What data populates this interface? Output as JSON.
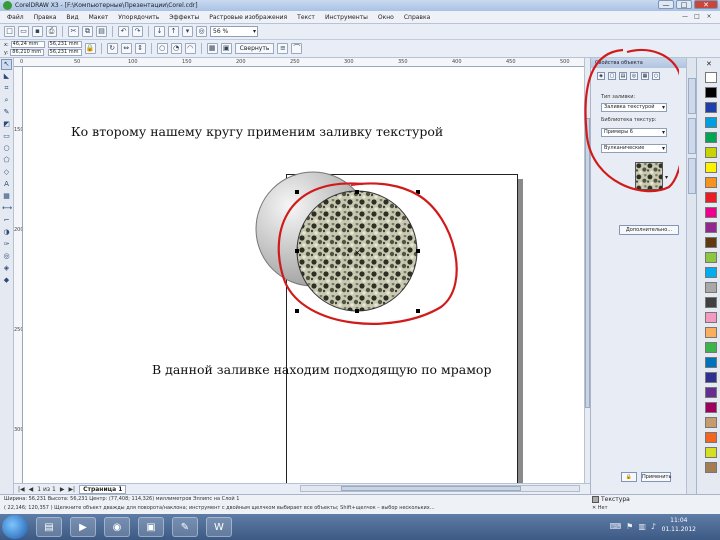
{
  "window": {
    "title": "CorelDRAW X3 - [F:\\Компьютерные\\Презентации\\Corel.cdr]",
    "controls": [
      "—",
      "□",
      "✕"
    ]
  },
  "menu": {
    "items": [
      "Файл",
      "Правка",
      "Вид",
      "Макет",
      "Упорядочить",
      "Эффекты",
      "Растровые изображения",
      "Текст",
      "Инструменты",
      "Окно",
      "Справка"
    ],
    "doc_controls": [
      "—",
      "□",
      "×"
    ]
  },
  "toolbar": {
    "zoom_value": "56 %",
    "snap_label": "Свернуть"
  },
  "propbar": {
    "x_value": "46,24 mm",
    "y_value": "86,210 mm",
    "w_value": "56,231 mm",
    "h_value": "56,231 mm"
  },
  "ruler": {
    "h_ticks": [
      "0",
      "50",
      "100",
      "150",
      "200",
      "250",
      "300",
      "350",
      "400",
      "450",
      "500"
    ],
    "v_ticks": [
      "150",
      "200",
      "250",
      "300"
    ]
  },
  "canvas": {
    "caption_top": "Ко второму нашему кругу применим заливку текстурой",
    "caption_bottom": "В данной заливке находим подходящую по мрамор"
  },
  "docker": {
    "title": "Свойства объекта",
    "fill_type_label": "Тип заливки:",
    "fill_type_value": "Заливка текстурой",
    "library_label": "Библиотека текстур:",
    "library_value": "Примеры 6",
    "texture_value": "Вулканические",
    "more_button": "Дополнительно...",
    "apply_button": "Применить"
  },
  "pagebar": {
    "page_count": "1 из 1",
    "page_tab": "Страница 1"
  },
  "status": {
    "line1": "Ширина: 56,231  Высота: 56,231  Центр: (77,408; 114,326) миллиметров    Эллипс на Слой 1",
    "line2": "( 22,146; 120,357 )   Щелкните объект дважды для поворота/наклона; инструмент с двойным щелчком выбирает все объекты; Shift+щелчок – выбор нескольких...",
    "fill_name": "Текстура",
    "stroke_name": "Нет"
  },
  "taskbar": {
    "time": "11:04",
    "date": "01.11.2012",
    "apps": [
      "explorer",
      "media",
      "corel",
      "presentation",
      "paint",
      "word"
    ]
  },
  "palette_colors": [
    "#ffffff",
    "#000000",
    "#1f3fa8",
    "#00a0e0",
    "#00a651",
    "#c8d400",
    "#fff200",
    "#f7941d",
    "#ed1c24",
    "#ec008c",
    "#92278f",
    "#603913",
    "#8dc63f",
    "#00aeef",
    "#a8a8a8",
    "#404040",
    "#f49ac1",
    "#fbaf5d",
    "#39b54a",
    "#0072bc",
    "#2e3192",
    "#662d91",
    "#9e005d",
    "#c69c6d",
    "#f26522",
    "#d7df23",
    "#a67c52"
  ]
}
